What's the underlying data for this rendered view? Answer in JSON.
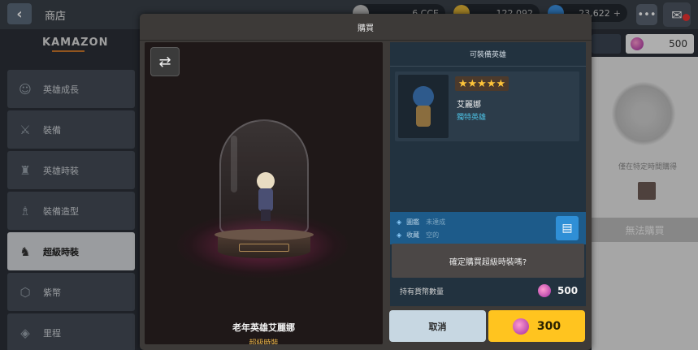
{
  "topbar": {
    "back_icon": "chevron-left-icon",
    "title": "商店",
    "resources": [
      {
        "icon": "token-icon",
        "value": "6,CCE"
      },
      {
        "icon": "gold-coin-icon",
        "value": "122,092"
      },
      {
        "icon": "crystal-icon",
        "value": "23,622"
      }
    ],
    "chat_icon": "chat-bubble-icon",
    "mail_icon": "mail-icon"
  },
  "logo": "KAMAZON",
  "sidebar": {
    "items": [
      {
        "label": "英雄成長",
        "icon": "hero-growth-icon",
        "active": false
      },
      {
        "label": "裝備",
        "icon": "equipment-icon",
        "active": false
      },
      {
        "label": "英雄時裝",
        "icon": "hero-costume-icon",
        "active": false
      },
      {
        "label": "裝備造型",
        "icon": "equipment-skin-icon",
        "active": false
      },
      {
        "label": "超級時裝",
        "icon": "super-costume-icon",
        "active": true
      },
      {
        "label": "紫幣",
        "icon": "purple-coin-icon",
        "active": false
      },
      {
        "label": "里程",
        "icon": "mileage-icon",
        "active": false
      }
    ]
  },
  "background_right": {
    "currency_value": "500",
    "caption": "僅在特定時間購得",
    "button_label": "無法購買"
  },
  "modal": {
    "title": "購買",
    "preview": {
      "swap_icon": "swap-arrows-icon",
      "item_name": "老年英雄艾麗娜",
      "item_type": "超級時裝"
    },
    "info": {
      "header": "可裝備英雄",
      "hero_card": {
        "stars": "★★★★★",
        "name": "艾麗娜",
        "tag": "獨特英雄"
      },
      "collection": [
        {
          "label": "圖鑑",
          "value": "未達成"
        },
        {
          "label": "收藏",
          "value": "空的"
        }
      ],
      "memo_icon": "memo-icon"
    },
    "confirm_text": "確定購買超級時裝嗎?",
    "owned_label": "持有貨幣數量",
    "owned_value": "500",
    "cancel_label": "取消",
    "buy_price": "300",
    "colors": {
      "buy_button": "#ffc41f",
      "cancel_button": "#c7d7e2",
      "collection_bar": "#1d5b8a"
    }
  }
}
